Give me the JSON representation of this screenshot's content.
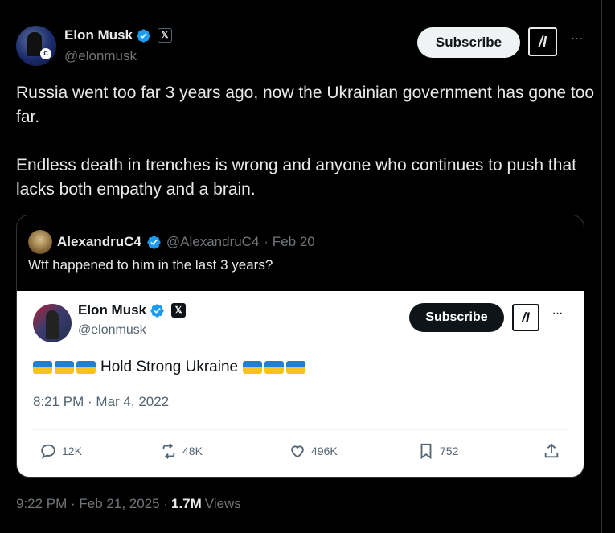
{
  "tweet": {
    "author_name": "Elon Musk",
    "author_handle": "@elonmusk",
    "x_badge": "𝕏",
    "subscribe_label": "Subscribe",
    "grok_label": "/I",
    "more_label": "···",
    "paragraphs": [
      "Russia went too far 3 years ago, now the Ukrainian government has gone too far.",
      "Endless death in trenches is wrong and anyone who continues to push that lacks both empathy and a brain."
    ],
    "timestamp": "9:22 PM · Feb 21, 2025 · ",
    "views_count": "1.7M",
    "views_label": "Views"
  },
  "quote": {
    "author_name": "AlexandruC4",
    "author_handle": "@AlexandruC4",
    "date": "· Feb 20",
    "text": "Wtf happened to him in the last 3 years?",
    "embedded": {
      "author_name": "Elon Musk",
      "author_handle": "@elonmusk",
      "x_badge": "𝕏",
      "subscribe_label": "Subscribe",
      "grok_label": "/I",
      "more_label": "···",
      "text": "Hold Strong Ukraine",
      "timestamp": "8:21 PM · Mar 4, 2022",
      "replies": "12K",
      "reposts": "48K",
      "likes": "496K",
      "bookmarks": "752"
    }
  },
  "colors": {
    "background": "#000000",
    "verified": "#1d9bf0",
    "flag_blue": "#1d7fd6",
    "flag_yellow": "#f7c21b"
  },
  "icons": [
    "verified-badge-icon",
    "x-logo-icon",
    "grok-icon",
    "more-icon",
    "reply-icon",
    "repost-icon",
    "like-icon",
    "bookmark-icon",
    "share-icon",
    "ukraine-flag-icon"
  ]
}
